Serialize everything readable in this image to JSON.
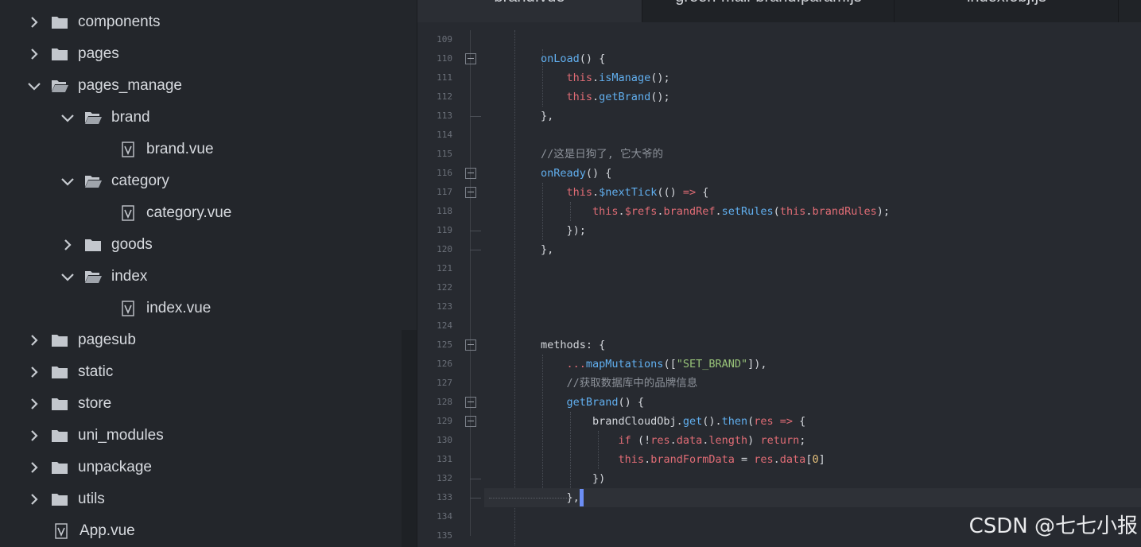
{
  "sidebar": {
    "items": [
      {
        "label": "components",
        "type": "folder",
        "state": "collapsed",
        "depth": 0
      },
      {
        "label": "pages",
        "type": "folder",
        "state": "collapsed",
        "depth": 0
      },
      {
        "label": "pages_manage",
        "type": "folder",
        "state": "expanded",
        "depth": 0
      },
      {
        "label": "brand",
        "type": "folder",
        "state": "expanded",
        "depth": 1
      },
      {
        "label": "brand.vue",
        "type": "vue-file",
        "depth": 2
      },
      {
        "label": "category",
        "type": "folder",
        "state": "expanded",
        "depth": 1
      },
      {
        "label": "category.vue",
        "type": "vue-file",
        "depth": 2
      },
      {
        "label": "goods",
        "type": "folder",
        "state": "collapsed",
        "depth": 1
      },
      {
        "label": "index",
        "type": "folder",
        "state": "expanded",
        "depth": 1
      },
      {
        "label": "index.vue",
        "type": "vue-file",
        "depth": 2
      },
      {
        "label": "pagesub",
        "type": "folder",
        "state": "collapsed",
        "depth": 0
      },
      {
        "label": "static",
        "type": "folder",
        "state": "collapsed",
        "depth": 0
      },
      {
        "label": "store",
        "type": "folder",
        "state": "collapsed",
        "depth": 0
      },
      {
        "label": "uni_modules",
        "type": "folder",
        "state": "collapsed",
        "depth": 0
      },
      {
        "label": "unpackage",
        "type": "folder",
        "state": "collapsed",
        "depth": 0
      },
      {
        "label": "utils",
        "type": "folder",
        "state": "collapsed",
        "depth": 0
      },
      {
        "label": "App.vue",
        "type": "vue-file",
        "depth": 0
      }
    ]
  },
  "tabs": [
    {
      "label": "brand.vue",
      "active": true
    },
    {
      "label": "green-mall-brand.param.js",
      "active": false
    },
    {
      "label": "index.obj.js",
      "active": false
    }
  ],
  "editor": {
    "lines": [
      {
        "num": "109",
        "text": ""
      },
      {
        "num": "110",
        "text": "onLoad() {"
      },
      {
        "num": "111",
        "text": "    this.isManage();"
      },
      {
        "num": "112",
        "text": "    this.getBrand();"
      },
      {
        "num": "113",
        "text": "},"
      },
      {
        "num": "114",
        "text": ""
      },
      {
        "num": "115",
        "text": "//这是日狗了, 它大爷的"
      },
      {
        "num": "116",
        "text": "onReady() {"
      },
      {
        "num": "117",
        "text": "    this.$nextTick(() => {"
      },
      {
        "num": "118",
        "text": "        this.$refs.brandRef.setRules(this.brandRules);"
      },
      {
        "num": "119",
        "text": "    });"
      },
      {
        "num": "120",
        "text": "},"
      },
      {
        "num": "121",
        "text": ""
      },
      {
        "num": "122",
        "text": ""
      },
      {
        "num": "123",
        "text": ""
      },
      {
        "num": "124",
        "text": ""
      },
      {
        "num": "125",
        "text": "methods: {"
      },
      {
        "num": "126",
        "text": "    ...mapMutations([\"SET_BRAND\"]),"
      },
      {
        "num": "127",
        "text": "    //获取数据库中的品牌信息"
      },
      {
        "num": "128",
        "text": "    getBrand() {"
      },
      {
        "num": "129",
        "text": "        brandCloudObj.get().then(res => {"
      },
      {
        "num": "130",
        "text": "            if (!res.data.length) return;"
      },
      {
        "num": "131",
        "text": "            this.brandFormData = res.data[0]"
      },
      {
        "num": "132",
        "text": "        })"
      },
      {
        "num": "133",
        "text": "    },"
      },
      {
        "num": "134",
        "text": ""
      },
      {
        "num": "135",
        "text": ""
      }
    ]
  },
  "watermark": "CSDN @七七小报",
  "colors": {
    "background": "#23262b",
    "editor_bg": "#272a30",
    "keyword": "#e06c75",
    "function": "#61afef",
    "string": "#98c379",
    "number": "#e5c07b",
    "comment": "#8e939b",
    "cursor": "#6c8ef5"
  }
}
